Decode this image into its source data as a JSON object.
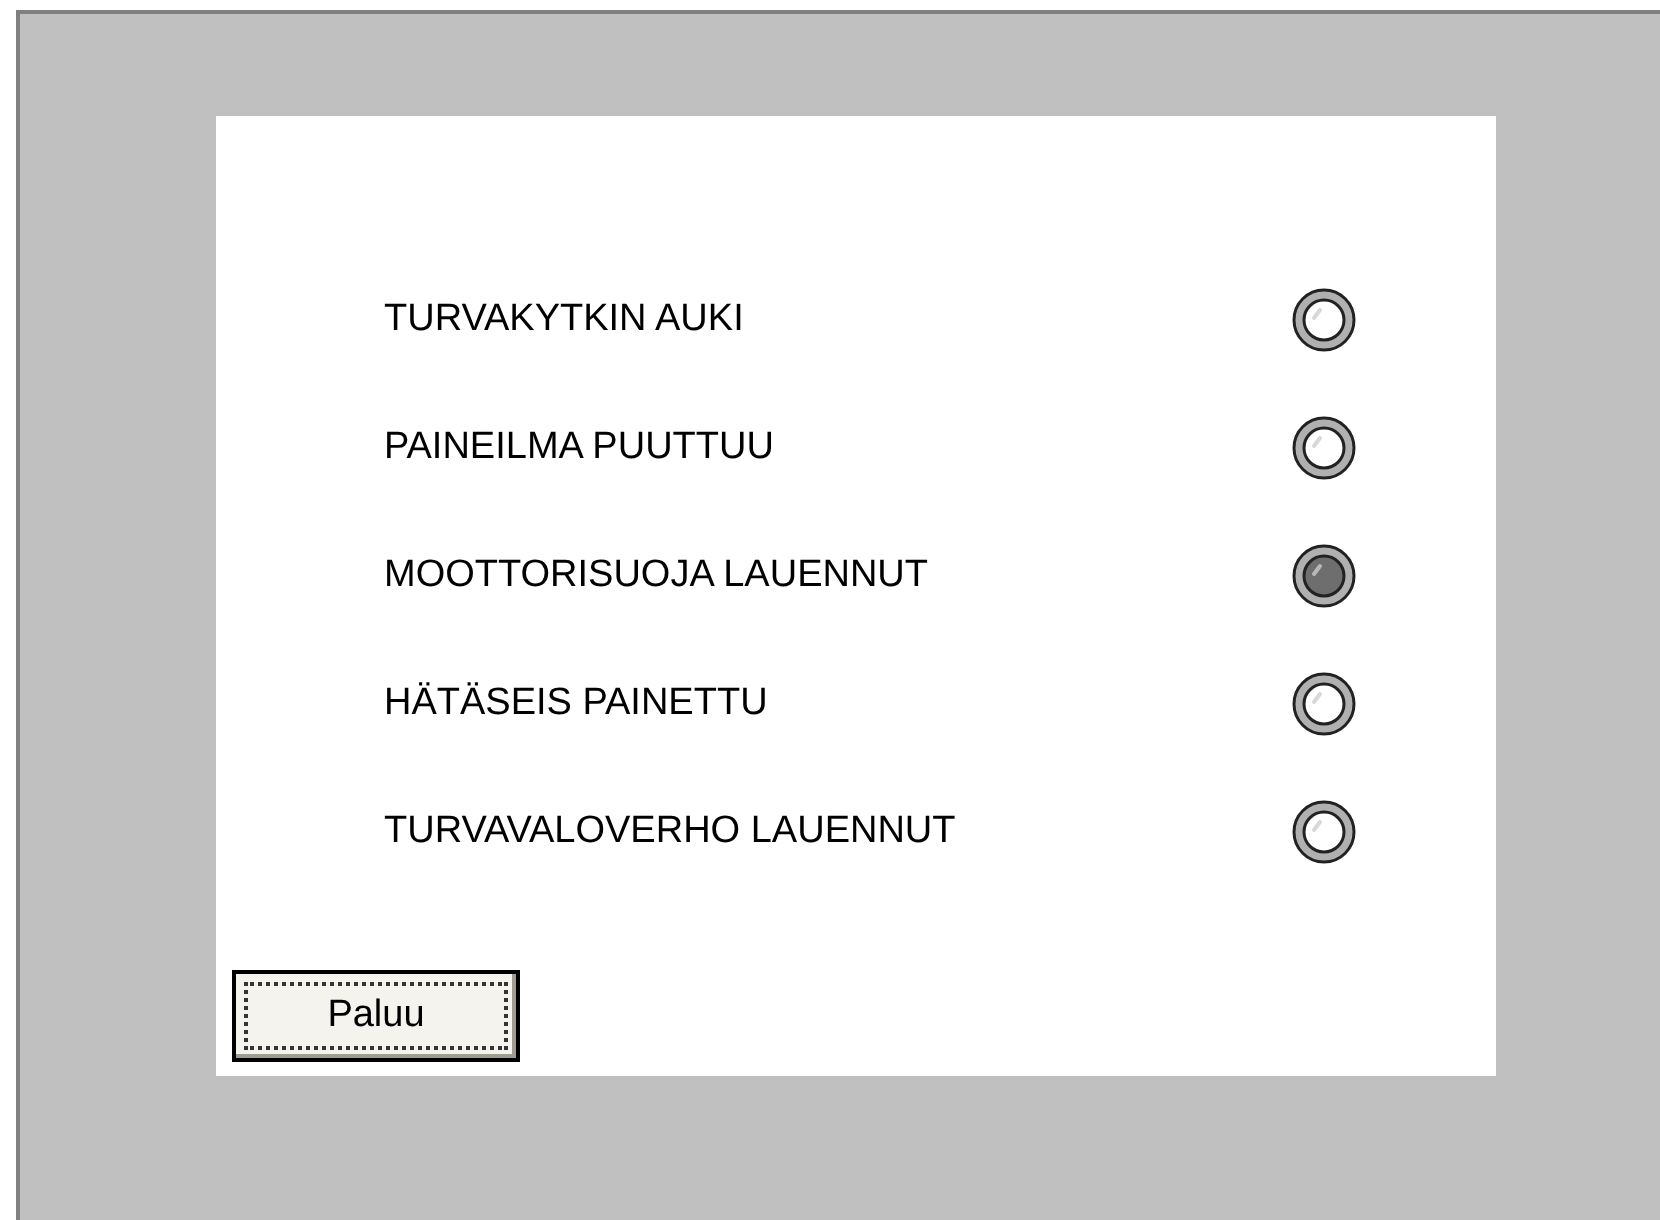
{
  "alarms": [
    {
      "label": "TURVAKYTKIN AUKI",
      "on": false
    },
    {
      "label": "PAINEILMA PUUTTUU",
      "on": false
    },
    {
      "label": "MOOTTORISUOJA LAUENNUT",
      "on": true
    },
    {
      "label": "HÄTÄSEIS PAINETTU",
      "on": false
    },
    {
      "label": "TURVAVALOVERHO LAUENNUT",
      "on": false
    }
  ],
  "button": {
    "label": "Paluu"
  }
}
